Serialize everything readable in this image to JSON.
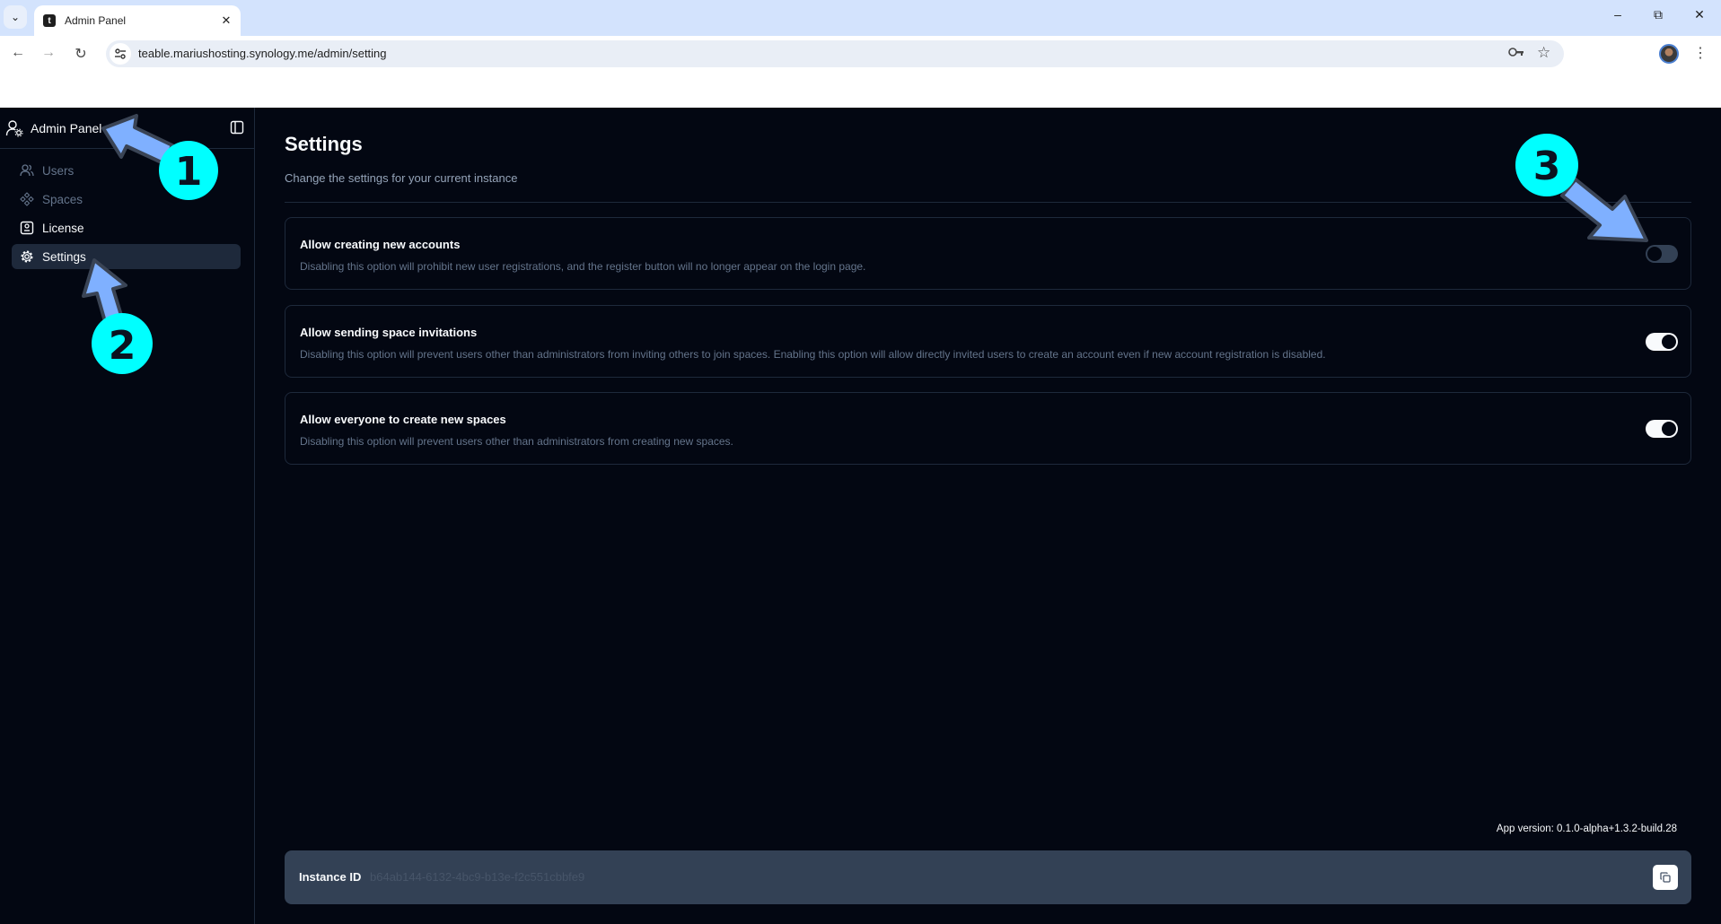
{
  "browser": {
    "tab_title": "Admin Panel",
    "favicon_letter": "t",
    "url": "teable.mariushosting.synology.me/admin/setting",
    "icons": {
      "tab_menu": "chevron-down-icon",
      "close_tab": "close-icon",
      "minimize": "minimize-icon",
      "restore": "restore-icon",
      "close_window": "close-icon",
      "back": "arrow-left-icon",
      "forward": "arrow-right-icon",
      "reload": "reload-icon",
      "site_info": "tune-icon",
      "password": "key-icon",
      "bookmark": "star-icon",
      "profile": "avatar-icon",
      "menu": "kebab-icon"
    }
  },
  "sidebar": {
    "title": "Admin Panel",
    "title_icon": "user-cog-icon",
    "collapse_icon": "panel-left-icon",
    "items": [
      {
        "label": "Users",
        "icon": "users-icon",
        "state": "disabled"
      },
      {
        "label": "Spaces",
        "icon": "component-icon",
        "state": "disabled"
      },
      {
        "label": "License",
        "icon": "license-icon",
        "state": "normal"
      },
      {
        "label": "Settings",
        "icon": "settings-icon",
        "state": "active"
      }
    ]
  },
  "main": {
    "title": "Settings",
    "subtitle": "Change the settings for your current instance",
    "settings": [
      {
        "title": "Allow creating new accounts",
        "description": "Disabling this option will prohibit new user registrations, and the register button will no longer appear on the login page.",
        "enabled": false
      },
      {
        "title": "Allow sending space invitations",
        "description": "Disabling this option will prevent users other than administrators from inviting others to join spaces. Enabling this option will allow directly invited users to create an account even if new account registration is disabled.",
        "enabled": true
      },
      {
        "title": "Allow everyone to create new spaces",
        "description": "Disabling this option will prevent users other than administrators from creating new spaces.",
        "enabled": true
      }
    ],
    "app_version": "App version: 0.1.0-alpha+1.3.2-build.28",
    "instance": {
      "label": "Instance ID",
      "value": "b64ab144-6132-4bc9-b13e-f2c551cbbfe9",
      "copy_icon": "copy-icon"
    }
  },
  "annotations": {
    "badge_color": "#00ffff",
    "arrow_color": "#7fb0ff",
    "badges": [
      "1",
      "2",
      "3"
    ]
  }
}
